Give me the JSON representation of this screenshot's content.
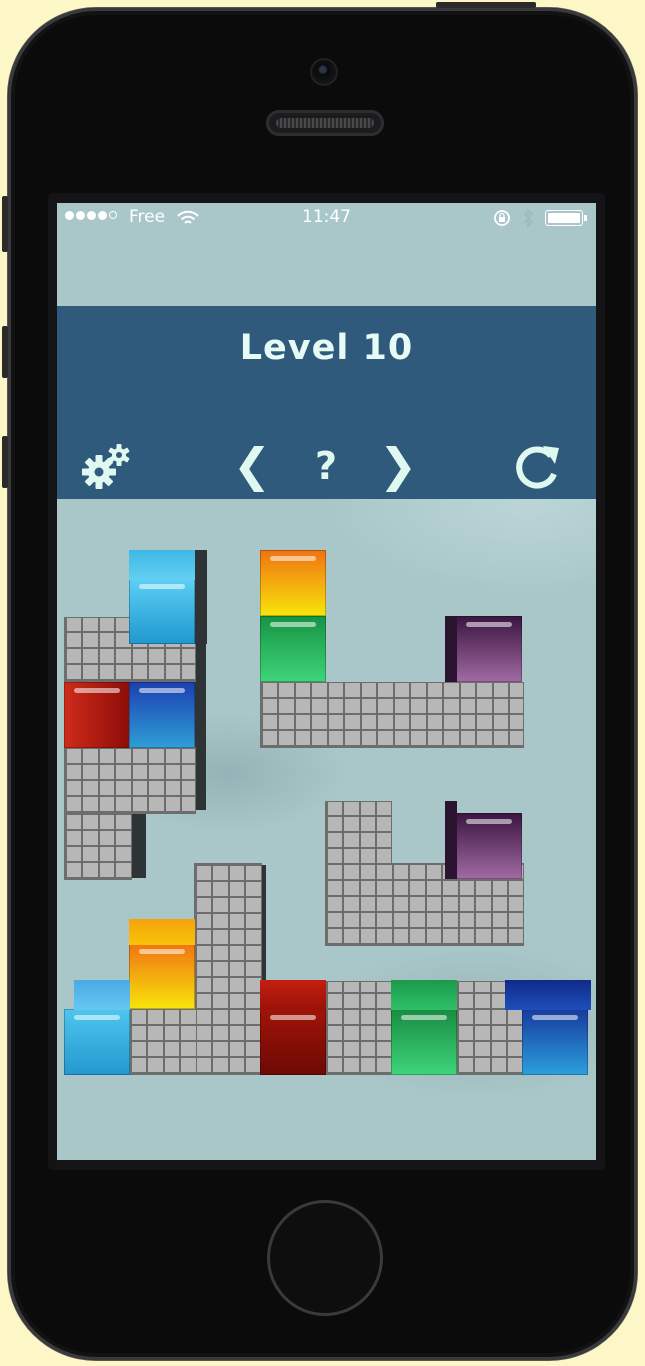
{
  "status_bar": {
    "carrier": "Free",
    "time": "11:47",
    "signal_dots": 4
  },
  "header": {
    "title": "Level 10"
  },
  "controls": {
    "settings_icon": "gears-icon",
    "prev_label": "❮",
    "help_label": "?",
    "next_label": "❯",
    "restart_icon": "restart-icon"
  },
  "block_colors": {
    "cyan": "#3db6e6",
    "blue": "#1e62c9",
    "red": "#b2170f",
    "orange_yellow": "#f5b40c",
    "green": "#1fa84b",
    "purple": "#6e2f6e"
  },
  "blocks": [
    {
      "color": "cyan"
    },
    {
      "color": "red"
    },
    {
      "color": "blue"
    },
    {
      "color": "orange_yellow"
    },
    {
      "color": "green"
    },
    {
      "color": "purple"
    },
    {
      "color": "purple"
    },
    {
      "color": "orange_yellow"
    },
    {
      "color": "cyan"
    },
    {
      "color": "red"
    },
    {
      "color": "green"
    },
    {
      "color": "blue"
    }
  ]
}
